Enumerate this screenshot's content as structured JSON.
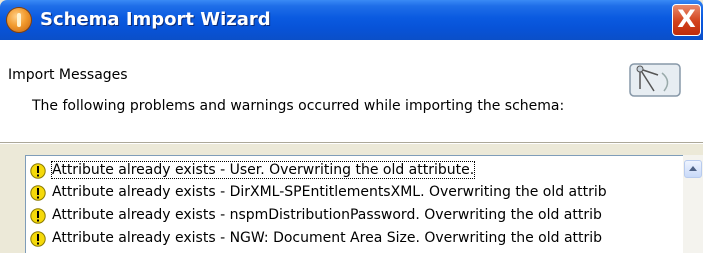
{
  "window": {
    "title": "Schema Import Wizard",
    "close_label": "X"
  },
  "header": {
    "section_title": "Import Messages",
    "description": "The following problems and warnings occurred while importing the schema:"
  },
  "messages": [
    {
      "icon": "warning-icon",
      "text": "Attribute already exists - User.  Overwriting the old attribute."
    },
    {
      "icon": "warning-icon",
      "text": "Attribute already exists - DirXML-SPEntitlementsXML.  Overwriting the old attrib"
    },
    {
      "icon": "warning-icon",
      "text": "Attribute already exists - nspmDistributionPassword.  Overwriting the old attrib"
    },
    {
      "icon": "warning-icon",
      "text": "Attribute already exists - NGW: Document Area Size.  Overwriting the old attrib"
    }
  ],
  "colors": {
    "titlebar": "#0a5ae0",
    "close": "#d2421c",
    "warning": "#f5d90a"
  }
}
